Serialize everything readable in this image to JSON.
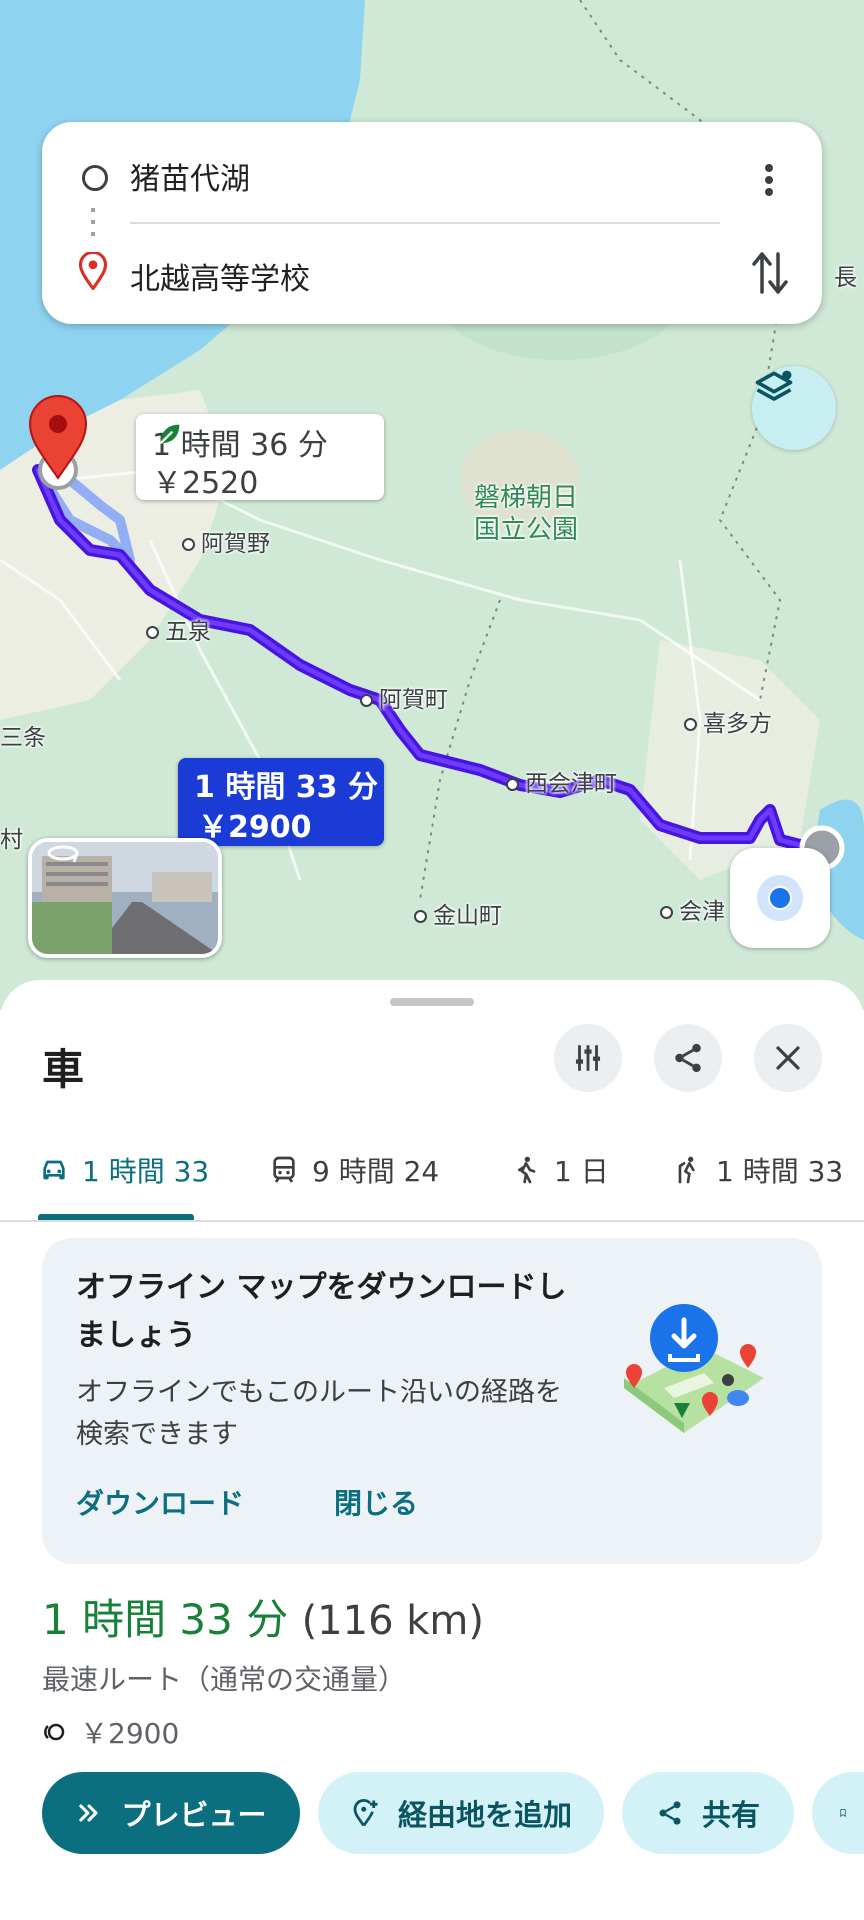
{
  "search": {
    "origin": "猪苗代湖",
    "destination": "北越高等学校"
  },
  "map": {
    "labels": {
      "agano": "阿賀野",
      "gosen": "五泉",
      "agamachi": "阿賀町",
      "nishiaizu": "西会津町",
      "kitakata": "喜多方",
      "kaneyama": "金山町",
      "aizu": "会津",
      "sanjo": "三条",
      "park": "磐梯朝日\n国立公園",
      "naga": "長",
      "mura": "村"
    },
    "alt_route": {
      "time": "1 時間 36 分",
      "fare": "￥2520"
    },
    "main_route": {
      "time": "1 時間 33 分",
      "fare": "￥2900"
    },
    "colors": {
      "route": "#4a14e0",
      "accent": "#0b6f80",
      "water": "#8ed4f0",
      "land": "#cfe9d6"
    }
  },
  "sheet": {
    "mode_title": "車",
    "tabs": [
      {
        "label": "1 時間 33",
        "icon": "car-icon"
      },
      {
        "label": "9 時間 24",
        "icon": "train-icon"
      },
      {
        "label": "1 日",
        "icon": "walk-icon"
      },
      {
        "label": "1 時間 33",
        "icon": "ride-icon"
      }
    ],
    "offline": {
      "title": "オフライン マップをダウンロードしましょう",
      "desc": "オフラインでもこのルート沿いの経路を検索できます",
      "download": "ダウンロード",
      "close": "閉じる"
    },
    "summary": {
      "time": "1 時間 33 分",
      "distance": "(116 km)",
      "subtitle": "最速ルート（通常の交通量）",
      "toll": "￥2900"
    },
    "actions": {
      "preview": "プレビュー",
      "add_stop": "経由地を追加",
      "share": "共有"
    }
  }
}
